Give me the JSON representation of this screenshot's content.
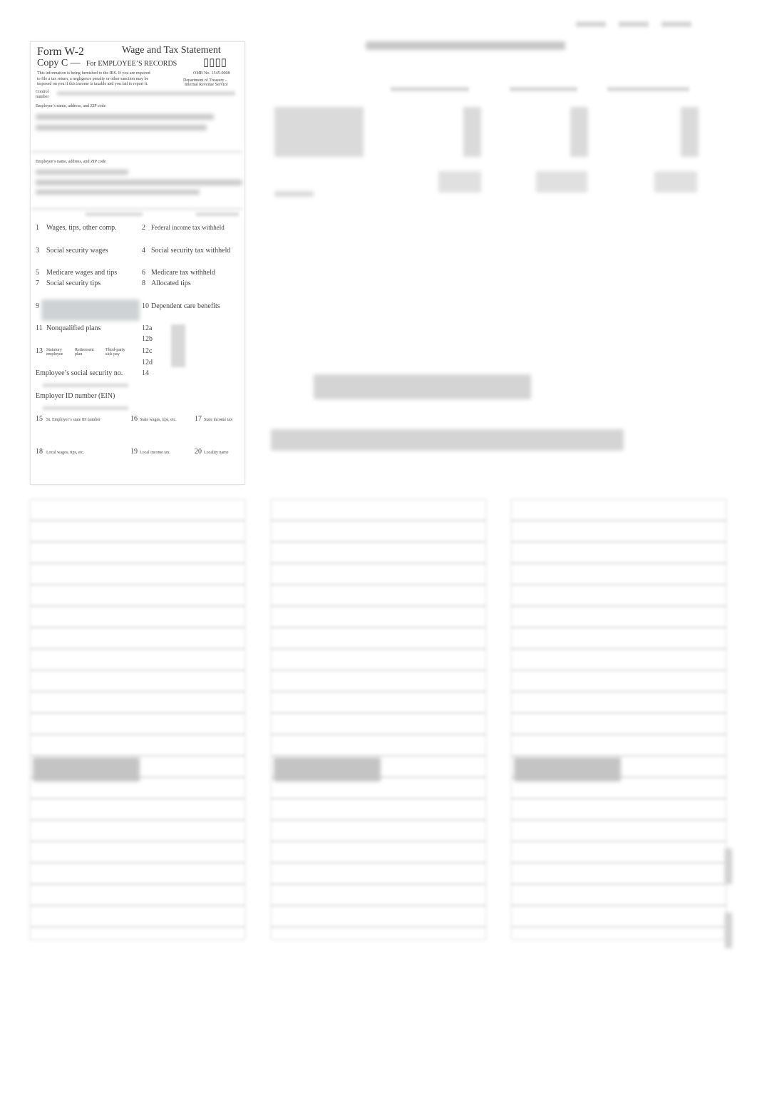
{
  "form": {
    "title": "Form W-2",
    "subtitle": "Wage and Tax Statement",
    "copy": "Copy C —",
    "copy_for": "For EMPLOYEE’S RECORDS",
    "year_glyphs": "▯▯▯▯",
    "notice_lines": [
      "This information is being furnished to the IRS. If you are required",
      "to file a tax return, a negligence penalty or other sanction may be",
      "imposed on you if this income is taxable and you fail to report it."
    ],
    "omb": "OMB No. 1545-0008",
    "dept": [
      "Department of Treasury -",
      "Internal Revenue Service"
    ],
    "control_number": [
      "Control",
      "number"
    ],
    "employer_label": "Employer’s name, address, and ZIP code",
    "employee_label": "Employee’s name, address, and ZIP code",
    "boxes": {
      "b1": {
        "num": "1",
        "label": "Wages, tips, other comp."
      },
      "b2": {
        "num": "2",
        "label": "Federal income tax withheld"
      },
      "b3": {
        "num": "3",
        "label": "Social security wages"
      },
      "b4": {
        "num": "4",
        "label": "Social security tax withheld"
      },
      "b5": {
        "num": "5",
        "label": "Medicare wages and tips"
      },
      "b6": {
        "num": "6",
        "label": "Medicare tax withheld"
      },
      "b7": {
        "num": "7",
        "label": "Social security tips"
      },
      "b8": {
        "num": "8",
        "label": "Allocated tips"
      },
      "b9": {
        "num": "9"
      },
      "b10": {
        "num": "10",
        "label": "Dependent care benefits"
      },
      "b11": {
        "num": "11",
        "label": "Nonqualified plans"
      },
      "b12a": "12a",
      "b12b": "12b",
      "b12c": "12c",
      "b12d": "12d",
      "b13": {
        "num": "13",
        "statutory": [
          "Statutory",
          "employee"
        ],
        "retirement": [
          "Retirement",
          "plan"
        ],
        "thirdparty": [
          "Third-party",
          "sick pay"
        ]
      },
      "b14": "14",
      "ssn": "Employee’s social security no.",
      "ein": "Employer ID number (EIN)",
      "b15": {
        "num": "15",
        "label": "St.  Employer’s state ID number"
      },
      "b16": {
        "num": "16",
        "label": "State wages, tips, etc."
      },
      "b17": {
        "num": "17",
        "label": "State income tax"
      },
      "b18": {
        "num": "18",
        "label": "Local wages, tips, etc."
      },
      "b19": {
        "num": "19",
        "label": "Local income tax"
      },
      "b20": {
        "num": "20",
        "label": "Locality name"
      }
    }
  }
}
